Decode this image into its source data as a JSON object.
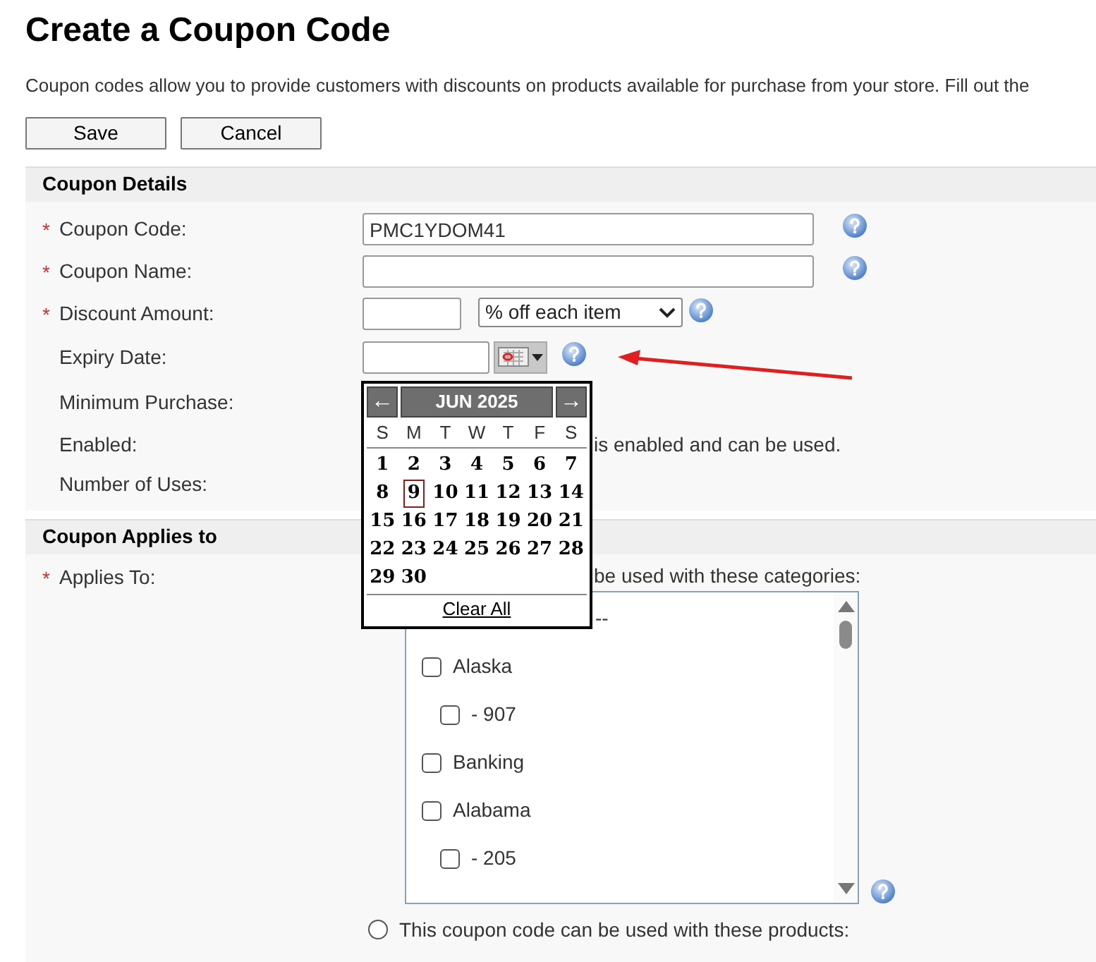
{
  "title": "Create a Coupon Code",
  "description": "Coupon codes allow you to provide customers with discounts on products available for purchase from your store. Fill out the",
  "buttons": [
    "Save",
    "Cancel"
  ],
  "details": {
    "title": "Coupon Details",
    "fields": [
      {
        "kind": "text",
        "marker": "*",
        "label": "Coupon Code:",
        "value": "PMC1YDOM41",
        "help": true
      },
      {
        "kind": "text",
        "marker": "*",
        "label": "Coupon Name:",
        "help": true
      },
      {
        "kind": "amount",
        "marker": "*",
        "label": "Discount Amount:",
        "select": "% off each item",
        "help": true
      },
      {
        "kind": "date",
        "label": "Expiry Date:",
        "help": true
      },
      {
        "kind": "blank",
        "label": "Minimum Purchase:"
      },
      {
        "kind": "note",
        "label": "Enabled:",
        "note": "is enabled and can be used."
      },
      {
        "kind": "blank",
        "label": "Number of Uses:"
      }
    ]
  },
  "calendar": {
    "prev": "←",
    "month": "JUN 2025",
    "next": "→",
    "weekdays": [
      "S",
      "M",
      "T",
      "W",
      "T",
      "F",
      "S"
    ],
    "days": [
      {
        "day": "1",
        "selected": false
      },
      {
        "day": "2",
        "selected": false
      },
      {
        "day": "3",
        "selected": false
      },
      {
        "day": "4",
        "selected": false
      },
      {
        "day": "5",
        "selected": false
      },
      {
        "day": "6",
        "selected": false
      },
      {
        "day": "7",
        "selected": false
      },
      {
        "day": "8",
        "selected": false
      },
      {
        "day": "9",
        "selected": true
      },
      {
        "day": "10",
        "selected": false
      },
      {
        "day": "11",
        "selected": false
      },
      {
        "day": "12",
        "selected": false
      },
      {
        "day": "13",
        "selected": false
      },
      {
        "day": "14",
        "selected": false
      },
      {
        "day": "15",
        "selected": false
      },
      {
        "day": "16",
        "selected": false
      },
      {
        "day": "17",
        "selected": false
      },
      {
        "day": "18",
        "selected": false
      },
      {
        "day": "19",
        "selected": false
      },
      {
        "day": "20",
        "selected": false
      },
      {
        "day": "21",
        "selected": false
      },
      {
        "day": "22",
        "selected": false
      },
      {
        "day": "23",
        "selected": false
      },
      {
        "day": "24",
        "selected": false
      },
      {
        "day": "25",
        "selected": false
      },
      {
        "day": "26",
        "selected": false
      },
      {
        "day": "27",
        "selected": false
      },
      {
        "day": "28",
        "selected": false
      },
      {
        "day": "29",
        "selected": false
      },
      {
        "day": "30",
        "selected": false
      }
    ],
    "clear": "Clear All"
  },
  "applies": {
    "title": "Coupon Applies to",
    "marker": "*",
    "label": "Applies To:",
    "categories_option": "be used with these categories:",
    "categories": [
      {
        "kind": "heading",
        "label": "--"
      },
      {
        "kind": "item",
        "label": "Alaska",
        "checked": false,
        "children": [
          {
            "kind": "item",
            "label": "- 907",
            "checked": false
          }
        ]
      },
      {
        "kind": "item",
        "label": "Banking",
        "checked": false
      },
      {
        "kind": "item",
        "label": "Alabama",
        "checked": false,
        "children": [
          {
            "kind": "item",
            "label": "- 205",
            "checked": false
          }
        ]
      }
    ],
    "list_help": true,
    "products_option": {
      "label": "This coupon code can be used with these products:",
      "selected": false
    }
  }
}
